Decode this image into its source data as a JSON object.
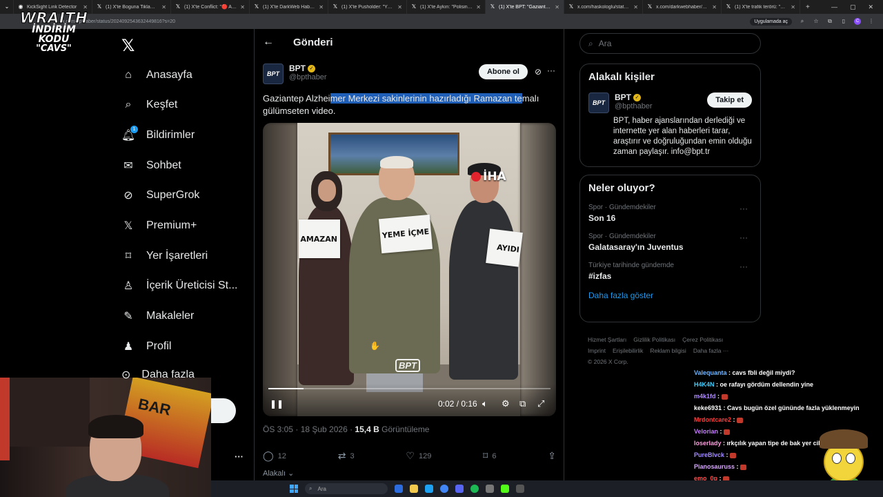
{
  "browser": {
    "tabs": [
      {
        "title": "KickSight Link Detector",
        "active": false
      },
      {
        "title": "(1) X'te Boguna Tiklama \"Rap...",
        "active": false
      },
      {
        "title": "(1) X'te Conflict: \"🔴 Amerika...",
        "active": false
      },
      {
        "title": "(1) X'te DarkWeb Haber: \"Me...",
        "active": false
      },
      {
        "title": "(1) X'te Pusholder: \"Yunanista...",
        "active": false
      },
      {
        "title": "(1) X'te Aykırı: \"Polisin silahın...",
        "active": false
      },
      {
        "title": "(1) X'te BPT: \"Gaziantep Alzhe...",
        "active": true
      },
      {
        "title": "x.com/haskologlu/status/20...",
        "active": false
      },
      {
        "title": "x.com/darkwebhaber/status/...",
        "active": false
      },
      {
        "title": "(1) X'te trafik terörü: \"Magan...",
        "active": false
      }
    ],
    "url": "x.com/bpthaber/status/2024092543632449816?s=20",
    "app_button": "Uygulamada aç"
  },
  "overlay": {
    "brand": "WRAITH",
    "line2": "İNDİRİM KODU",
    "line3": "\"CAVS\""
  },
  "nav": {
    "items": [
      {
        "label": "Anasayfa",
        "icon": "home-icon"
      },
      {
        "label": "Keşfet",
        "icon": "search-icon"
      },
      {
        "label": "Bildirimler",
        "icon": "bell-icon",
        "badge": "1"
      },
      {
        "label": "Sohbet",
        "icon": "mail-icon"
      },
      {
        "label": "SuperGrok",
        "icon": "grok-icon"
      },
      {
        "label": "Premium+",
        "icon": "x-logo-icon"
      },
      {
        "label": "Yer İşaretleri",
        "icon": "bookmark-icon"
      },
      {
        "label": "İçerik Üreticisi St...",
        "icon": "creator-studio-icon"
      },
      {
        "label": "Makaleler",
        "icon": "articles-icon"
      },
      {
        "label": "Profil",
        "icon": "profile-icon"
      },
      {
        "label": "Daha fazla",
        "icon": "more-circle-icon"
      }
    ]
  },
  "post": {
    "header": "Gönderi",
    "author_name": "BPT",
    "author_handle": "@bpthaber",
    "subscribe_label": "Abone ol",
    "text_before": "Gaziantep Alzhei",
    "text_highlight": "mer Merkezi sakinlerinin hazırladığı Ramazan te",
    "text_after": "malı gülümseten video.",
    "video": {
      "signs": [
        "AMAZAN",
        "YEME İÇME",
        "AYIDI"
      ],
      "watermark": "İHA",
      "logo": "BPT",
      "time_current": "0:02",
      "time_total": "0:16",
      "progress": 0.125
    },
    "timestamp": "ÖS 3:05 · 18 Şub 2026 · ",
    "views_count": "15,4 B",
    "views_label": " Görüntüleme",
    "replies": "12",
    "reposts": "3",
    "likes": "129",
    "bookmarks": "6",
    "sort_label": "Alakalı"
  },
  "sidebar": {
    "search_placeholder": "Ara",
    "related_title": "Alakalı kişiler",
    "related_name": "BPT",
    "related_handle": "@bpthaber",
    "follow_label": "Takip et",
    "related_bio": "BPT, haber ajanslarından derlediği ve internette yer alan haberleri tarar, araştırır ve doğruluğundan emin olduğu zaman paylaşır. info@bpt.tr",
    "trends_title": "Neler oluyor?",
    "trends": [
      {
        "category": "Spor · Gündemdekiler",
        "name": "Son 16"
      },
      {
        "category": "Spor · Gündemdekiler",
        "name": "Galatasaray'ın Juventus"
      },
      {
        "category": "Türkiye tarihinde gündemde",
        "name": "#izfas"
      }
    ],
    "show_more": "Daha fazla göster",
    "footer": [
      "Hizmet Şartları",
      "Gizlilik Politikası",
      "Çerez Politikası",
      "Imprint",
      "Erişilebilirlik",
      "Reklam bilgisi",
      "Daha fazla ···",
      "© 2026 X Corp."
    ]
  },
  "chat": [
    {
      "user": "Valequanta",
      "color": "#6fb6ff",
      "msg": "cavs fbli değil miydi?"
    },
    {
      "user": "H4K4N",
      "color": "#3fd0ff",
      "msg": "oe rafayı gördüm dellendin yine"
    },
    {
      "user": "m4k1fd",
      "color": "#b18cff",
      "msg": ""
    },
    {
      "user": "keke6931",
      "color": "#ffffff",
      "msg": "Cavs bugün özel gününde fazla yüklenmeyin"
    },
    {
      "user": "Mrdontcare2",
      "color": "#ff3b3b",
      "msg": ""
    },
    {
      "user": "Velorian",
      "color": "#c77dff",
      "msg": ""
    },
    {
      "user": "loserlady",
      "color": "#ff9de0",
      "msg": "ırkçılık yapan tipe de bak yer cilesi"
    },
    {
      "user": "PureBlvck",
      "color": "#a58bff",
      "msg": ""
    },
    {
      "user": "Pianosauruss",
      "color": "#d9a7ff",
      "msg": ""
    },
    {
      "user": "emo_0p",
      "color": "#ff4d4d",
      "msg": ""
    },
    {
      "user": "m4k1fd",
      "color": "#b18cff",
      "msg": ""
    }
  ],
  "taskbar": {
    "search_label": "Ara"
  }
}
